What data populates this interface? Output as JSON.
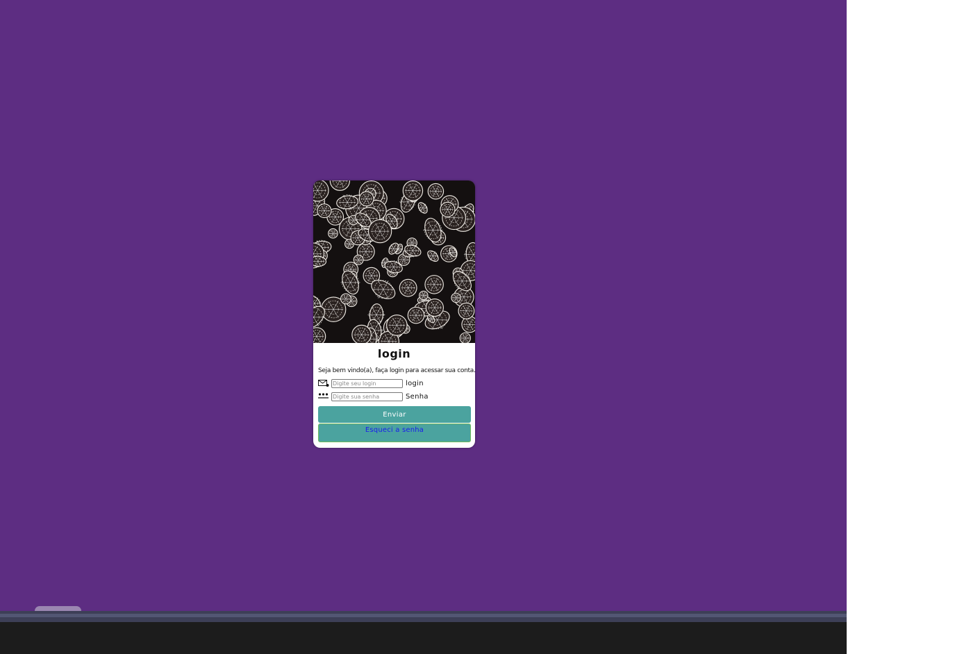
{
  "login_card": {
    "hero_image_alt": "",
    "title": "login",
    "welcome_text": "Seja bem vindo(a), faça login para acessar sua conta.",
    "fields": [
      {
        "icon": "envelope-icon",
        "placeholder": "Digite seu login",
        "value": "",
        "label": "login"
      },
      {
        "icon": "password-dots-icon",
        "placeholder": "Digite sua senha",
        "value": "",
        "label": "Senha"
      }
    ],
    "submit_label": "Enviar",
    "forgot_label": "Esqueci a senha"
  },
  "colors": {
    "page_background": "#5d2d82",
    "button_background": "#4ba39f",
    "link_color": "#1a1aee",
    "taskbar": "#1c1c1c"
  }
}
